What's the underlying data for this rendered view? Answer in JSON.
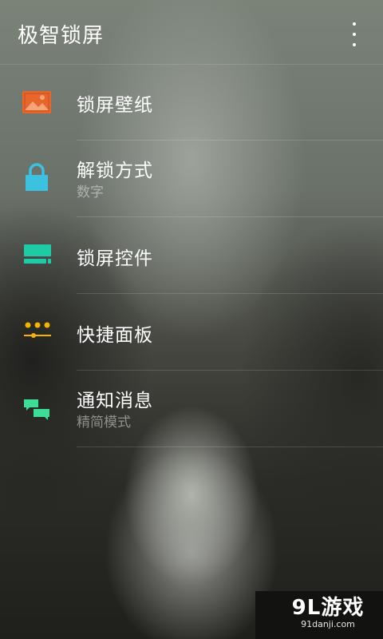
{
  "app": {
    "title": "极智锁屏"
  },
  "menu": {
    "overflow_icon": "more-vert-icon"
  },
  "items": [
    {
      "label": "锁屏壁纸",
      "sub": "",
      "icon": "wallpaper-icon",
      "color": "#e8652b"
    },
    {
      "label": "解锁方式",
      "sub": "数字",
      "icon": "lock-icon",
      "color": "#3ac2e0"
    },
    {
      "label": "锁屏控件",
      "sub": "",
      "icon": "widget-icon",
      "color": "#1fcaa6"
    },
    {
      "label": "快捷面板",
      "sub": "",
      "icon": "quick-panel-icon",
      "color": "#f4b400"
    },
    {
      "label": "通知消息",
      "sub": "精简模式",
      "icon": "chat-bubbles-icon",
      "color": "#3ddc97"
    }
  ],
  "watermark": {
    "logo": "9L游戏",
    "url": "91danji.com"
  }
}
